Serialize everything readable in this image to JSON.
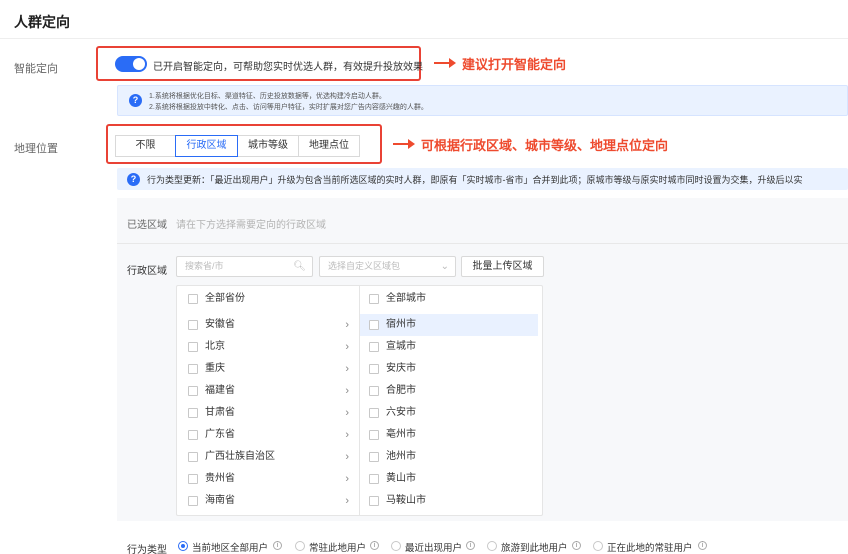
{
  "section_title": "人群定向",
  "smart": {
    "label": "智能定向",
    "enabled": true,
    "toggle_text": "已开启智能定向，可帮助您实时优选人群，有效提升投放效果",
    "annotation": "建议打开智能定向",
    "info_lines": [
      "1.系统将根据优化目标、渠道特征、历史投放数据等，优选构建冷启动人群。",
      "2.系统将根据投放中转化、点击、访问等用户特征，实时扩展对您广告内容感兴趣的人群。"
    ]
  },
  "geo": {
    "label": "地理位置",
    "segments": [
      "不限",
      "行政区域",
      "城市等级",
      "地理点位"
    ],
    "active_segment": "行政区域",
    "annotation": "可根据行政区域、城市等级、地理点位定向",
    "notice": "行为类型更新：「最近出现用户」升级为包含当前所选区域的实时人群，即原有「实时城市-省市」合并到此项；原城市等级与原实时城市同时设置为交集，升级后以实"
  },
  "selected": {
    "label": "已选区域",
    "hint": "请在下方选择需要定向的行政区域"
  },
  "admin_area": {
    "label": "行政区域",
    "search_placeholder": "搜索省/市",
    "package_placeholder": "选择自定义区域包",
    "upload_button": "批量上传区域",
    "provinces_header": "全部省份",
    "provinces": [
      "安徽省",
      "北京",
      "重庆",
      "福建省",
      "甘肃省",
      "广东省",
      "广西壮族自治区",
      "贵州省",
      "海南省"
    ],
    "selected_province": "安徽省",
    "cities_header": "全部城市",
    "cities": [
      "宿州市",
      "宣城市",
      "安庆市",
      "合肥市",
      "六安市",
      "亳州市",
      "池州市",
      "黄山市",
      "马鞍山市"
    ],
    "highlighted_city": "宿州市",
    "chevron": "›"
  },
  "behavior": {
    "label": "行为类型",
    "options": [
      "当前地区全部用户",
      "常驻此地用户",
      "最近出现用户",
      "旅游到此地用户",
      "正在此地的常驻用户"
    ],
    "selected": "当前地区全部用户",
    "info_icon": "i"
  },
  "colors": {
    "accent": "#2a6cf6",
    "annotation": "#ee4a2e",
    "info_bg": "#eaf2ff"
  }
}
